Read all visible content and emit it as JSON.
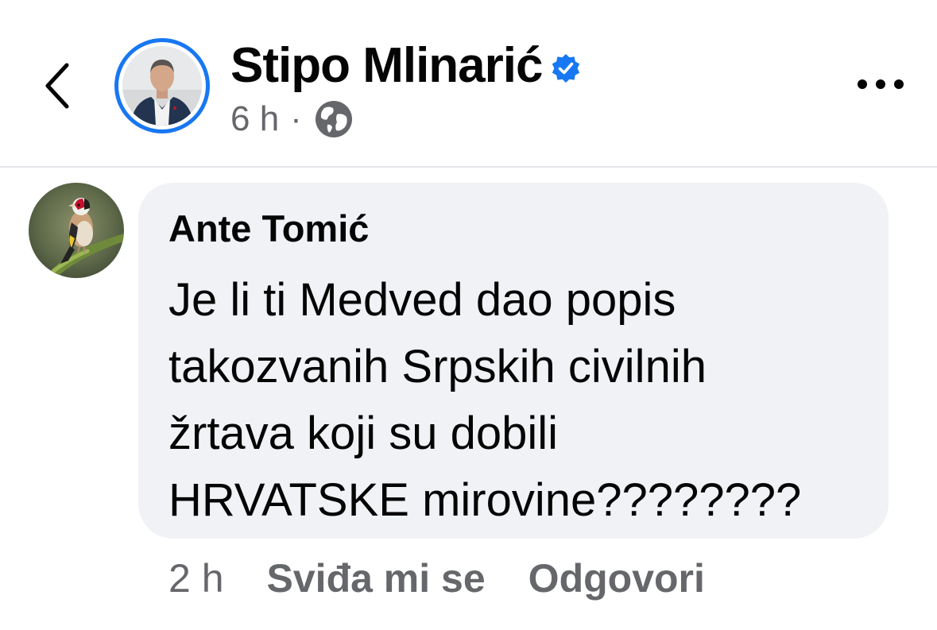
{
  "header": {
    "author_name": "Stipo Mlinarić",
    "time": "6 h",
    "separator": "·",
    "verified": true,
    "privacy_icon": "globe-icon",
    "back_icon": "chevron-left-icon",
    "more_icon": "more-horizontal-icon"
  },
  "comment": {
    "author": "Ante Tomić",
    "lines": [
      "Je li ti Medved dao popis",
      "takozvanih Srpskih civilnih",
      "žrtava koji su dobili",
      "HRVATSKE mirovine????????"
    ],
    "time": "2 h",
    "like_label": "Sviđa mi se",
    "reply_label": "Odgovori"
  },
  "colors": {
    "accent": "#1877f2",
    "text_primary": "#050505",
    "text_secondary": "#65676b",
    "bubble_bg": "#f0f2f5",
    "divider": "#e4e6eb"
  }
}
